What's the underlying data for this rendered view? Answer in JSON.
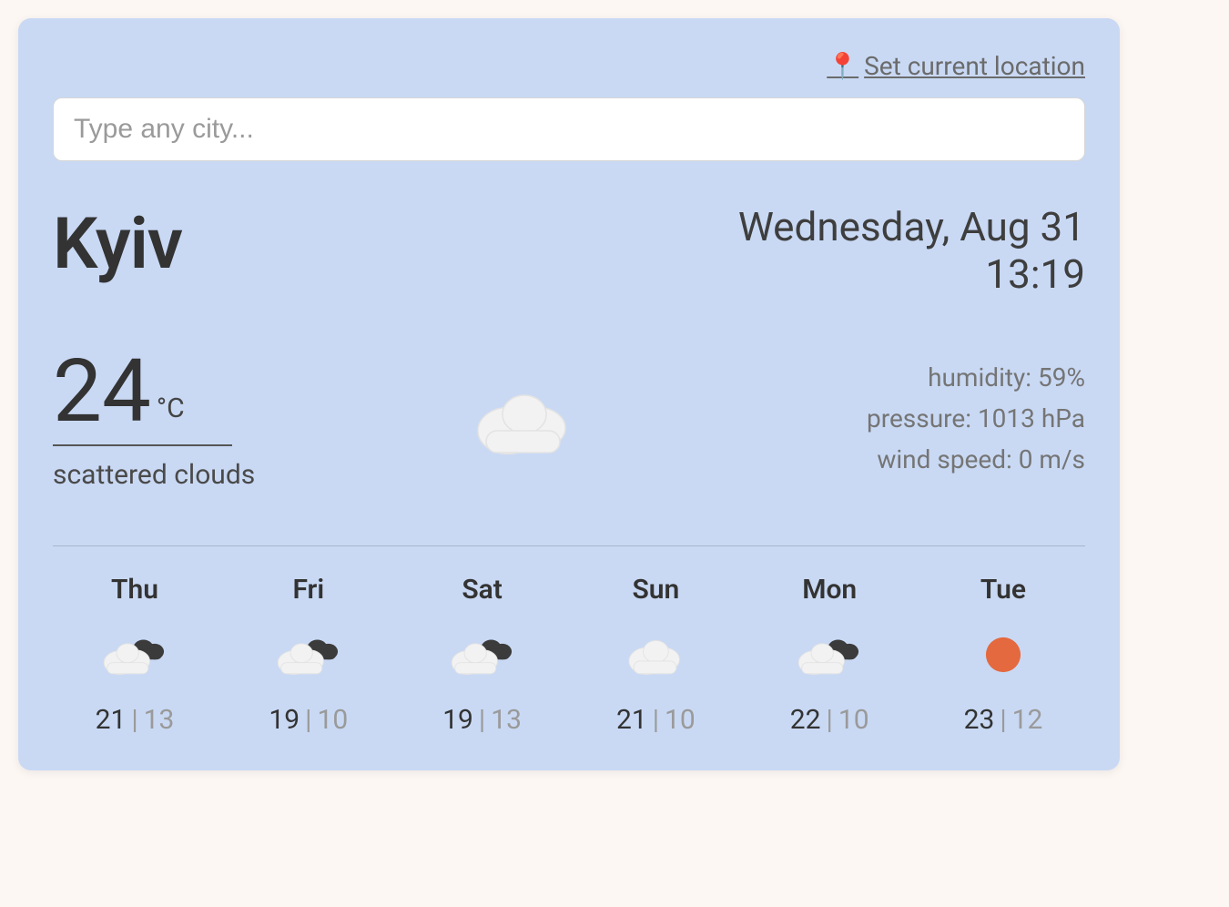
{
  "header": {
    "set_location_label": "Set current location",
    "pin_emoji": "📍"
  },
  "search": {
    "placeholder": "Type any city..."
  },
  "current": {
    "city": "Kyiv",
    "date": "Wednesday, Aug 31",
    "time": "13:19",
    "temp": "24",
    "unit": "°C",
    "condition": "scattered clouds",
    "humidity": "humidity: 59%",
    "pressure": "pressure: 1013 hPa",
    "wind": "wind speed: 0 m/s",
    "icon": "cloud"
  },
  "forecast": [
    {
      "day": "Thu",
      "icon": "broken",
      "high": "21",
      "low": "13"
    },
    {
      "day": "Fri",
      "icon": "broken",
      "high": "19",
      "low": "10"
    },
    {
      "day": "Sat",
      "icon": "broken",
      "high": "19",
      "low": "13"
    },
    {
      "day": "Sun",
      "icon": "cloud",
      "high": "21",
      "low": "10"
    },
    {
      "day": "Mon",
      "icon": "broken",
      "high": "22",
      "low": "10"
    },
    {
      "day": "Tue",
      "icon": "sun",
      "high": "23",
      "low": "12"
    }
  ]
}
